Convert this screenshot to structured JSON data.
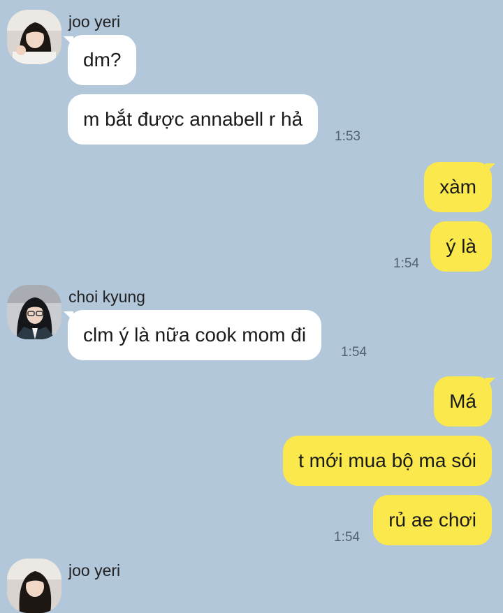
{
  "messages": {
    "group1": {
      "sender": "joo yeri",
      "bubble1": "dm?",
      "bubble2": "m bắt được annabell r hả",
      "time": "1:53"
    },
    "group2": {
      "bubble1": "xàm",
      "bubble2": "ý là",
      "time": "1:54"
    },
    "group3": {
      "sender": "choi kyung",
      "bubble1": "clm ý là nữa cook mom đi",
      "time": "1:54"
    },
    "group4": {
      "bubble1": "Má",
      "bubble2": "t mới mua bộ ma sói",
      "bubble3": "rủ ae chơi",
      "time": "1:54"
    },
    "group5": {
      "sender": "joo yeri"
    }
  },
  "colors": {
    "background": "#b2c7da",
    "incoming_bubble": "#ffffff",
    "outgoing_bubble": "#fae84d"
  }
}
